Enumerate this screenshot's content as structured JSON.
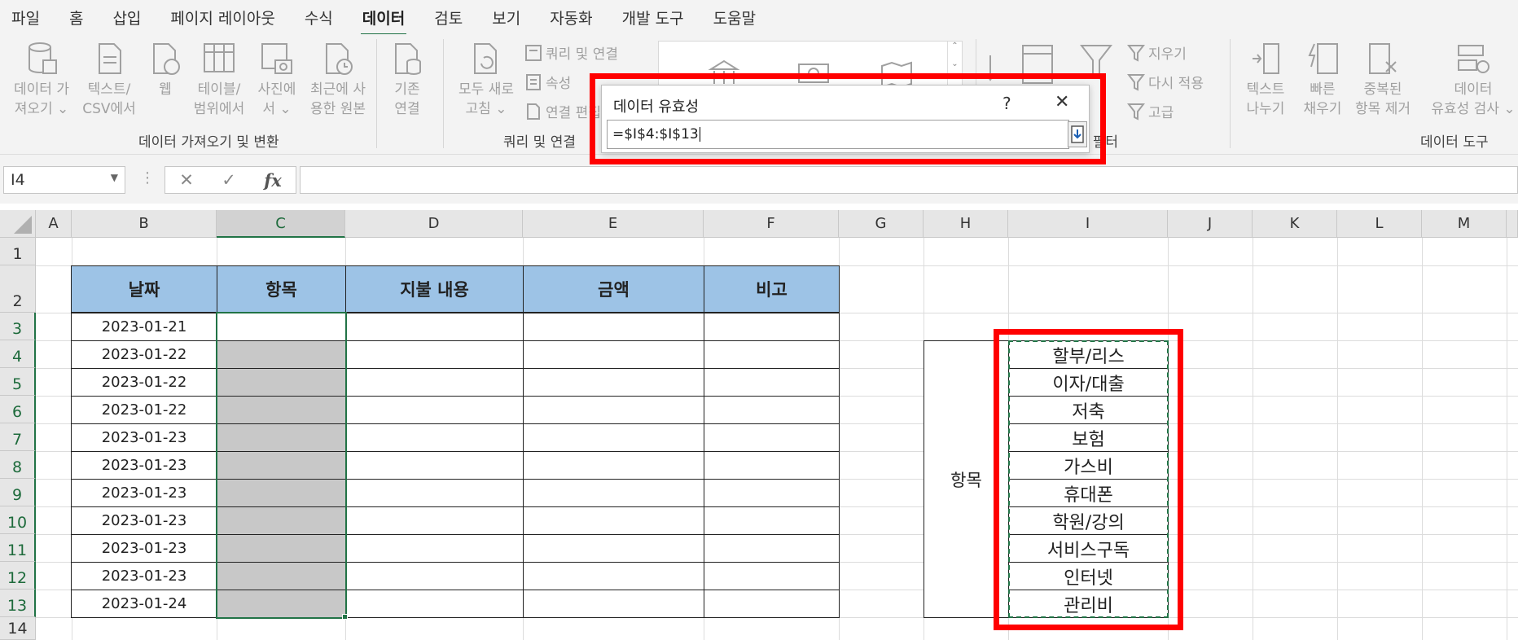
{
  "menu": {
    "tabs": [
      "파일",
      "홈",
      "삽입",
      "페이지 레이아웃",
      "수식",
      "데이터",
      "검토",
      "보기",
      "자동화",
      "개발 도구",
      "도움말"
    ],
    "active": "데이터"
  },
  "ribbon": {
    "get_data": {
      "line1": "데이터 가",
      "line2": "져오기 ⌄"
    },
    "text_csv": {
      "line1": "텍스트/",
      "line2": "CSV에서"
    },
    "web": {
      "line1": "웹"
    },
    "table_range": {
      "line1": "테이블/",
      "line2": "범위에서"
    },
    "from_picture": {
      "line1": "사진에",
      "line2": "서 ⌄"
    },
    "recent_sources": {
      "line1": "최근에 사",
      "line2": "용한 원본"
    },
    "existing": {
      "line1": "기존",
      "line2": "연결"
    },
    "group_get_transform": "데이터 가져오기 및 변환",
    "refresh_all": {
      "line1": "모두 새로",
      "line2": "고침 ⌄"
    },
    "queries_connections": "쿼리 및 연결",
    "properties": "속성",
    "edit_links": "연결 편집",
    "group_queries": "쿼리 및 연결",
    "clear": "지우기",
    "reapply": "다시 적용",
    "advanced": "고급",
    "group_sort_filter": "정렬 및 필터",
    "text_to_columns": {
      "line1": "텍스트",
      "line2": "나누기"
    },
    "flash_fill": {
      "line1": "빠른",
      "line2": "채우기"
    },
    "remove_duplicates": {
      "line1": "중복된",
      "line2": "항목 제거"
    },
    "data_validation": {
      "line1": "데이터",
      "line2": "유효성 검사 ⌄"
    },
    "group_data_tools": "데이터 도구"
  },
  "formula_bar": {
    "name_box": "I4",
    "cancel": "✕",
    "enter": "✓",
    "fx": "fx"
  },
  "columns": [
    "A",
    "B",
    "C",
    "D",
    "E",
    "F",
    "G",
    "H",
    "I",
    "J",
    "K",
    "L",
    "M"
  ],
  "rows": [
    "1",
    "2",
    "3",
    "4",
    "5",
    "6",
    "7",
    "8",
    "9",
    "10",
    "11",
    "12",
    "13",
    "14"
  ],
  "table": {
    "headers": [
      "날짜",
      "항목",
      "지불 내용",
      "금액",
      "비고"
    ],
    "dates": [
      "2023-01-21",
      "2023-01-22",
      "2023-01-22",
      "2023-01-22",
      "2023-01-23",
      "2023-01-23",
      "2023-01-23",
      "2023-01-23",
      "2023-01-23",
      "2023-01-23",
      "2023-01-24"
    ]
  },
  "item_list": {
    "label": "항목",
    "items": [
      "할부/리스",
      "이자/대출",
      "저축",
      "보험",
      "가스비",
      "휴대폰",
      "학원/강의",
      "서비스구독",
      "인터넷",
      "관리비"
    ]
  },
  "dialog": {
    "title": "데이터 유효성",
    "help": "?",
    "close": "✕",
    "formula": "=$I$4:$I$13"
  },
  "colors": {
    "accent": "#217346",
    "highlight": "#ff0000",
    "header_fill": "#9dc3e6"
  }
}
